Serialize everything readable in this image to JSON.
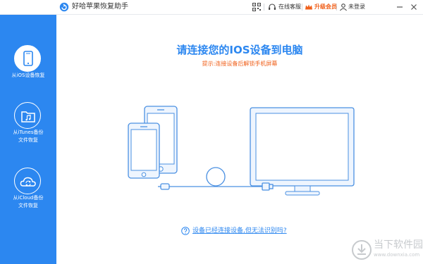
{
  "app": {
    "title": "好哈苹果恢复助手"
  },
  "titlebar": {
    "service_label": "在线客服",
    "vip_label": "升级会员",
    "login_label": "未登录",
    "icons": [
      "qr-code-icon",
      "headset-icon",
      "crown-icon",
      "user-icon",
      "minimize-icon",
      "close-icon"
    ]
  },
  "sidebar": {
    "items": [
      {
        "line1": "从iOS设备恢复",
        "line2": "",
        "icon": "phone-icon",
        "active": true
      },
      {
        "line1": "从iTunes备份",
        "line2": "文件恢复",
        "icon": "music-folder-icon",
        "active": false
      },
      {
        "line1": "从iCloud备份",
        "line2": "文件恢复",
        "icon": "cloud-sync-icon",
        "active": false
      }
    ]
  },
  "main": {
    "title": "请连接您的IOS设备到电脑",
    "subtitle": "提示:连接设备后解锁手机屏幕",
    "help_link": "设备已经连接设备,但无法识别吗?"
  },
  "watermark": {
    "name": "当下软件园",
    "url": "www.downxia.com"
  },
  "colors": {
    "primary": "#2c87f0",
    "accent": "#f0601b",
    "illustration_fill": "#eaf3fe",
    "illustration_stroke": "#4a90e2"
  }
}
